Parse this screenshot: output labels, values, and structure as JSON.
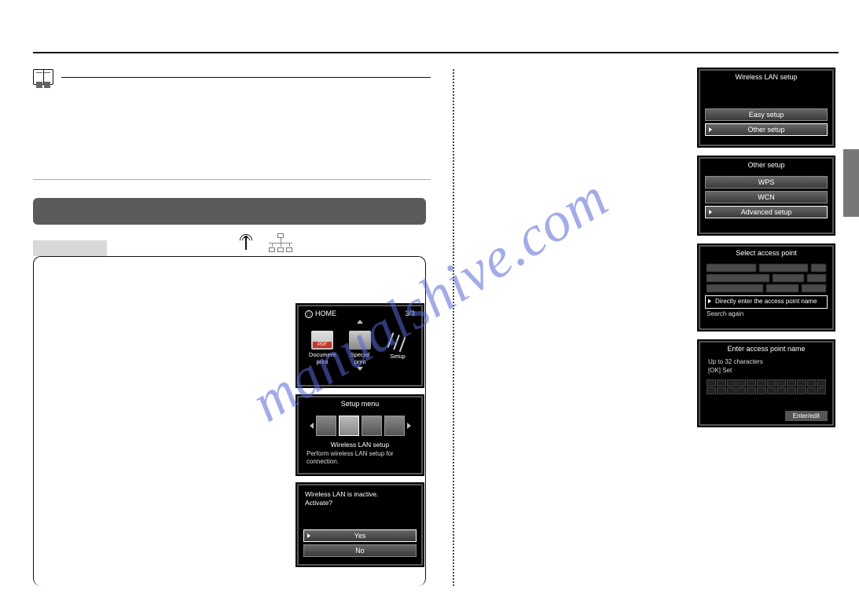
{
  "watermark": "manualshive.com",
  "home": {
    "label": "HOME",
    "page": "3/3",
    "items": [
      {
        "name": "Document print"
      },
      {
        "name": "Special print"
      },
      {
        "name": "Setup"
      }
    ]
  },
  "setup_menu": {
    "title": "Setup menu",
    "selected_label": "Wireless LAN setup",
    "description": "Perform wireless LAN setup for connection."
  },
  "activate": {
    "question_line1": "Wireless LAN is inactive.",
    "question_line2": "Activate?",
    "yes": "Yes",
    "no": "No"
  },
  "wlan_setup": {
    "title": "Wireless LAN setup",
    "easy": "Easy setup",
    "other": "Other setup"
  },
  "other_setup": {
    "title": "Other setup",
    "wps": "WPS",
    "wcn": "WCN",
    "advanced": "Advanced setup"
  },
  "select_ap": {
    "title": "Select access point",
    "direct": "Directly enter the access point name",
    "search": "Search again"
  },
  "enter_ap": {
    "title": "Enter access point name",
    "limit": "Up to 32 characters",
    "ok": "[OK] Set",
    "enter": "Enter/edit"
  }
}
